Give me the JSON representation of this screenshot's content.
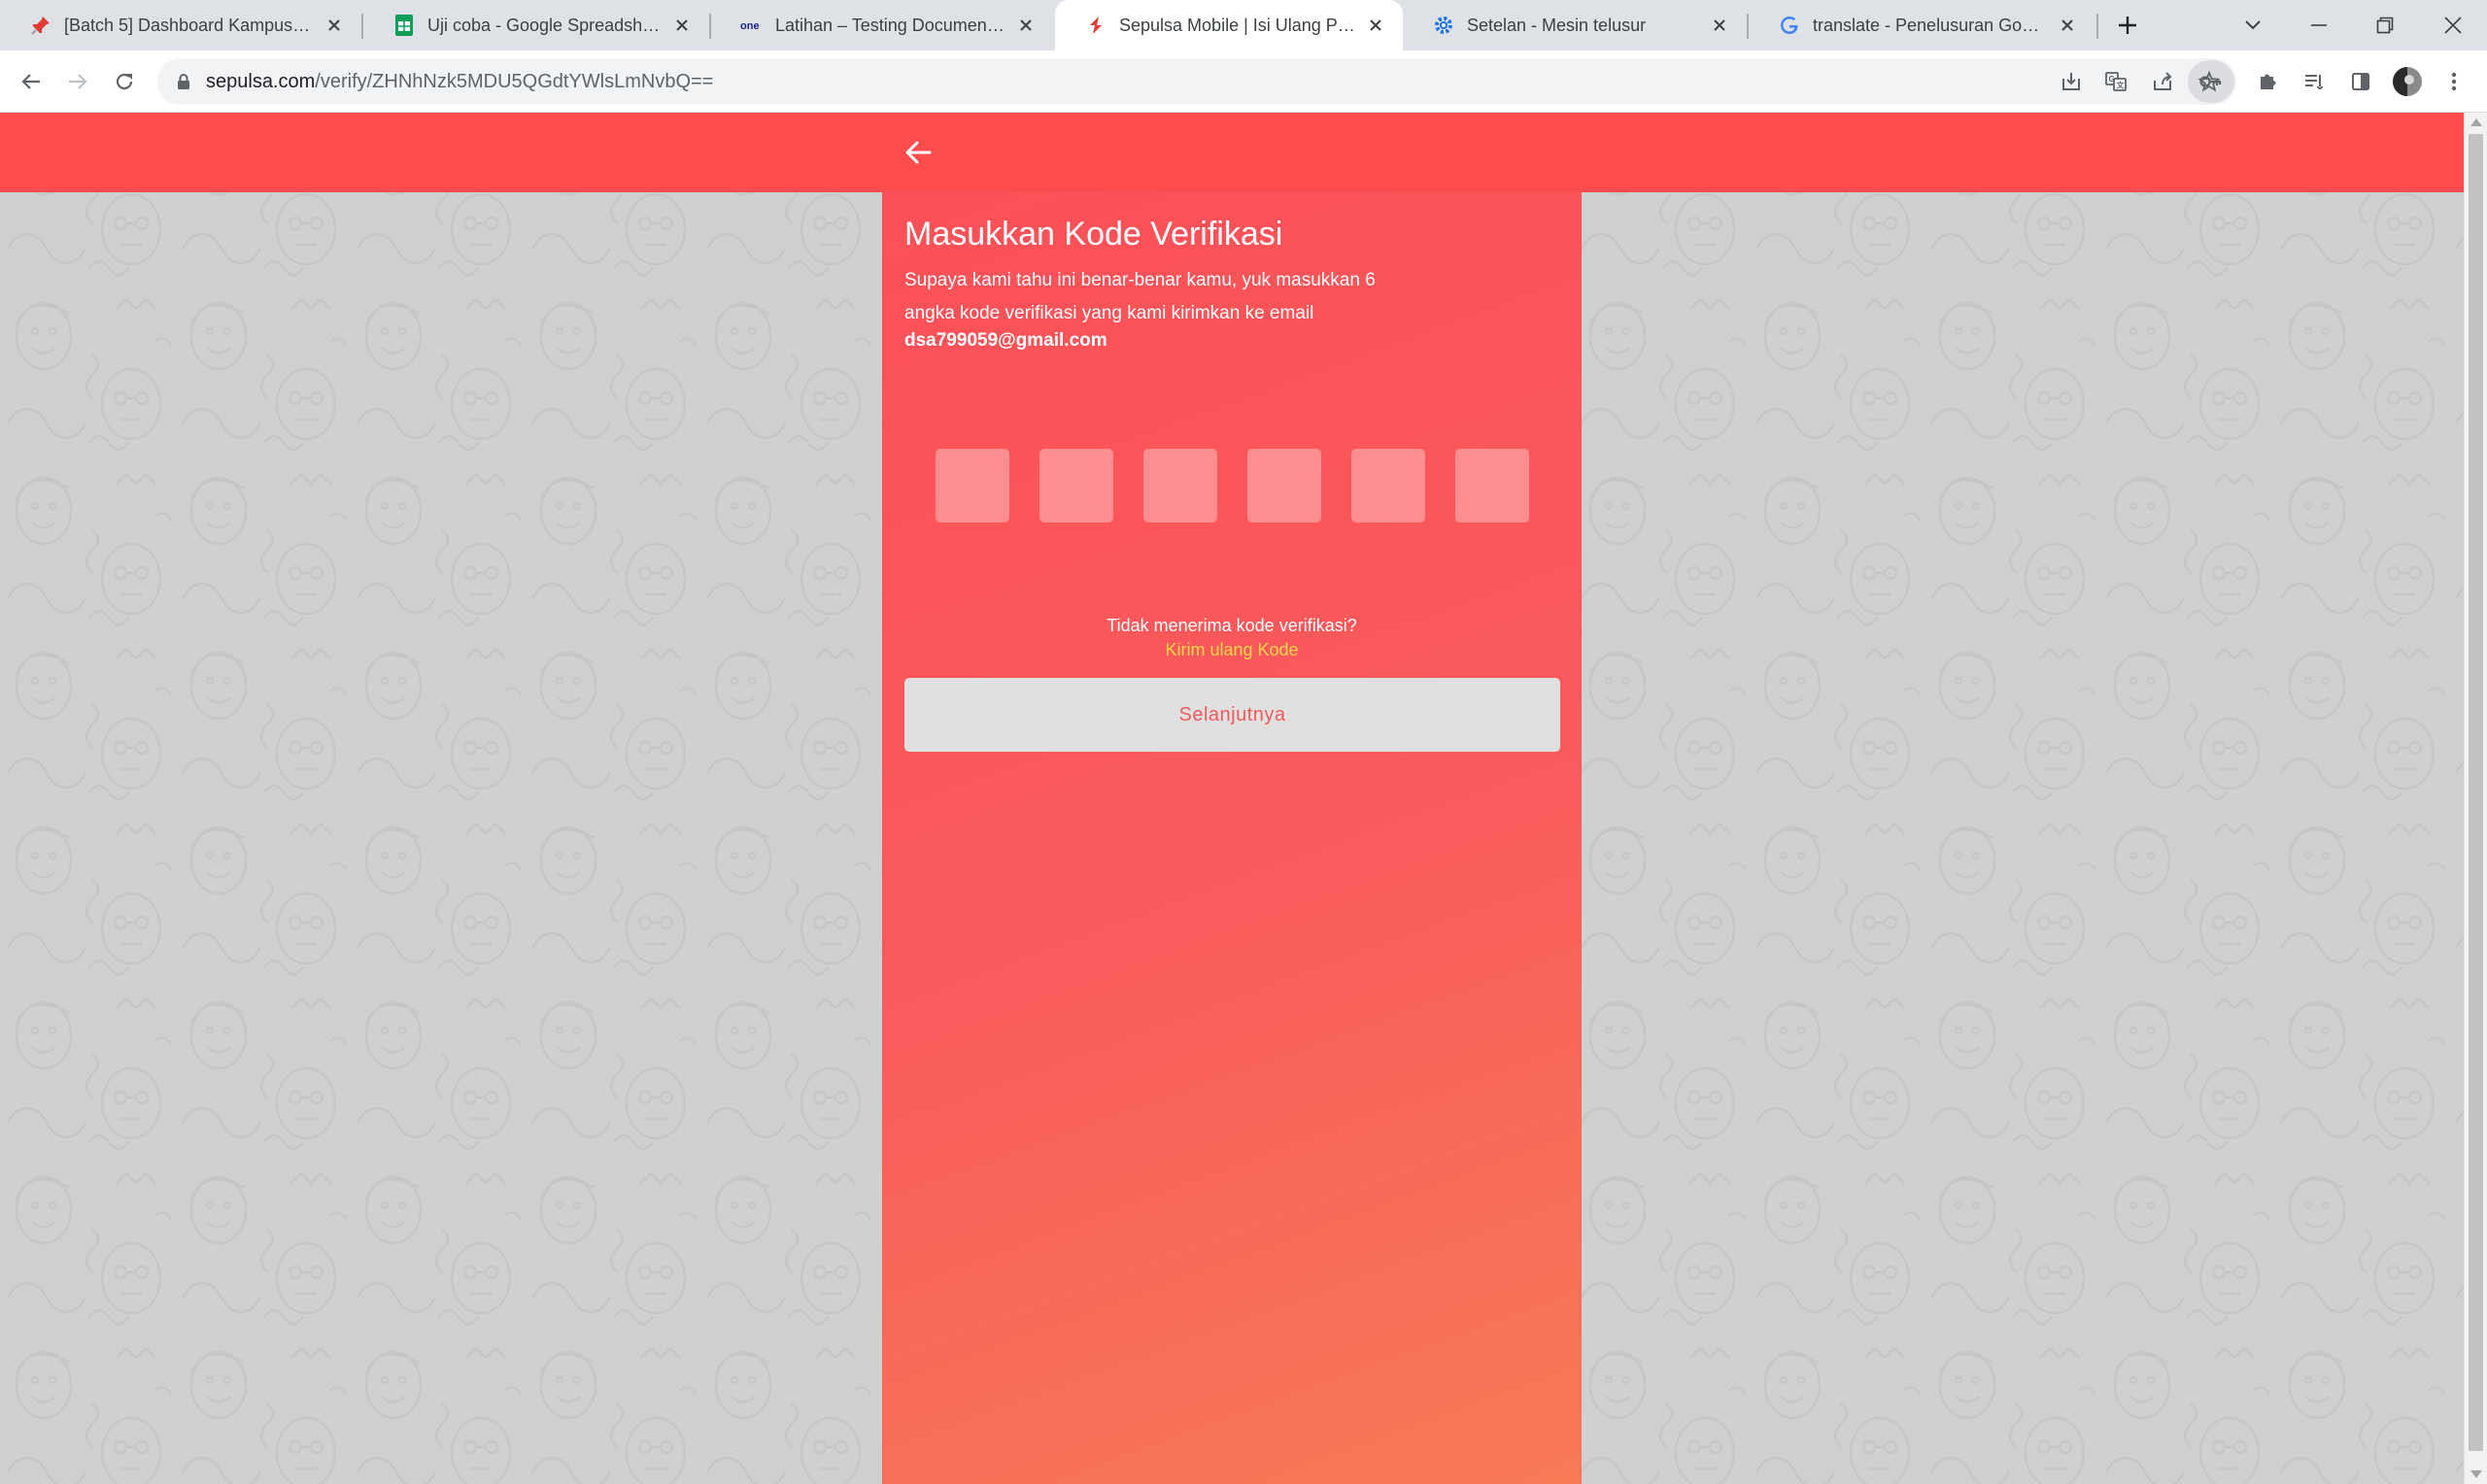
{
  "browser": {
    "tabs": [
      {
        "title": "[Batch 5] Dashboard Kampus Merdeka",
        "icon": "pushpin-icon",
        "active": false
      },
      {
        "title": "Uji coba - Google Spreadsheet",
        "icon": "sheets-icon",
        "active": false
      },
      {
        "title": "Latihan – Testing Documentation",
        "icon": "one-logo-icon",
        "active": false
      },
      {
        "title": "Sepulsa Mobile | Isi Ulang Pulsa",
        "icon": "sepulsa-logo-icon",
        "active": true
      },
      {
        "title": "Setelan - Mesin telusur",
        "icon": "settings-gear-icon",
        "active": false
      },
      {
        "title": "translate - Penelusuran Google",
        "icon": "google-g-icon",
        "active": false
      }
    ],
    "url_host": "sepulsa.com",
    "url_path": "/verify/ZHNhNzk5MDU5QGdtYWlsLmNvbQ==",
    "colors": {
      "tabstrip": "#dee1e6",
      "omnibox": "#f1f3f4"
    }
  },
  "page": {
    "heading": "Masukkan Kode Verifikasi",
    "subtitle": "Supaya kami tahu ini benar-benar kamu, yuk masukkan 6 angka kode verifikasi yang kami kirimkan ke email",
    "email": "dsa799059@gmail.com",
    "otp_values": [
      "",
      "",
      "",
      "",
      "",
      ""
    ],
    "no_code_text": "Tidak menerima kode verifikasi?",
    "resend_link": "Kirim ulang Kode",
    "next_button": "Selanjutnya",
    "colors": {
      "header": "#fd4b4e",
      "panel": "#f85c5c",
      "otp_box": "#fc8e8f",
      "link": "#ffd64a",
      "background": "#d0d0d0"
    }
  }
}
